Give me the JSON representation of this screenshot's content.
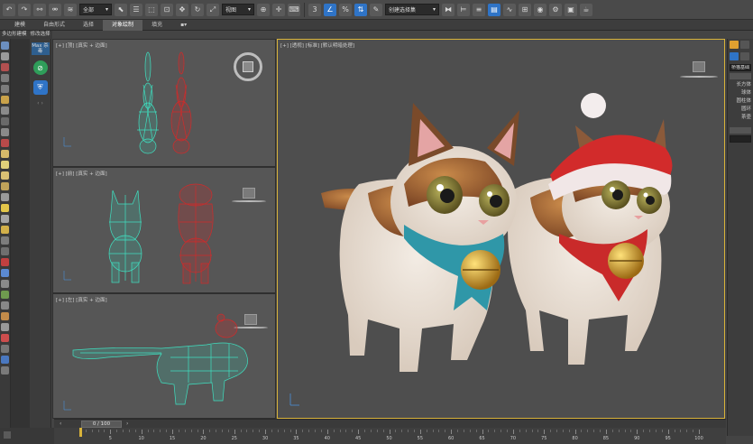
{
  "toolbar": {
    "selection_filter": "全部",
    "ref_coord": "视图",
    "named_selection": "创建选择集",
    "snap_label": "3"
  },
  "ribbon": {
    "tabs": [
      "建模",
      "自由形式",
      "选择",
      "对象绘制",
      "填充"
    ],
    "active": 3
  },
  "subbar": {
    "items": [
      "多边形建模",
      "修改选择"
    ]
  },
  "panel2": {
    "label": "Max 杀毒"
  },
  "viewports": {
    "top_label": "[+] [顶] [真实 + 边面]",
    "front_label": "[+] [前] [真实 + 边面]",
    "left_label": "[+] [左] [真实 + 边面]",
    "persp_label": "[+] [透视] [标准] [默认明暗处理]"
  },
  "right_panel": {
    "field": "桥猫基础",
    "items": [
      "长方体",
      "球体",
      "圆柱体",
      "圆环",
      "茶壶"
    ]
  },
  "timeline": {
    "frame": "0 / 100",
    "ticks": [
      5,
      10,
      15,
      20,
      25,
      30,
      35,
      40,
      45,
      50,
      55,
      60,
      65,
      70,
      75,
      80,
      85,
      90,
      95,
      100
    ]
  },
  "colors": {
    "accent": "#2f74c7",
    "persp_border": "#d8b33a",
    "wire_cyan": "#3fe0c0",
    "wire_red": "#d22a2a"
  }
}
